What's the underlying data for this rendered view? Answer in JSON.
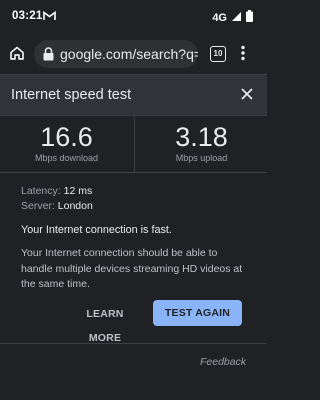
{
  "status_bar": {
    "time": "03:21",
    "network": "4G"
  },
  "browser": {
    "url": "google.com/search?q=speed+test",
    "tab_count": "10"
  },
  "card": {
    "title": "Internet speed test",
    "download": {
      "value": "16.6",
      "unit": "Mbps download"
    },
    "upload": {
      "value": "3.18",
      "unit": "Mbps upload"
    },
    "latency_label": "Latency:",
    "latency_value": "12 ms",
    "server_label": "Server:",
    "server_value": "London",
    "headline": "Your Internet connection is fast.",
    "description": "Your Internet connection should be able to handle multiple devices streaming HD videos at the same time.",
    "learn_more": "LEARN MORE",
    "test_again": "TEST AGAIN",
    "feedback": "Feedback"
  },
  "colors": {
    "accent": "#8ab4f8",
    "background": "#202124",
    "header": "#303438"
  }
}
